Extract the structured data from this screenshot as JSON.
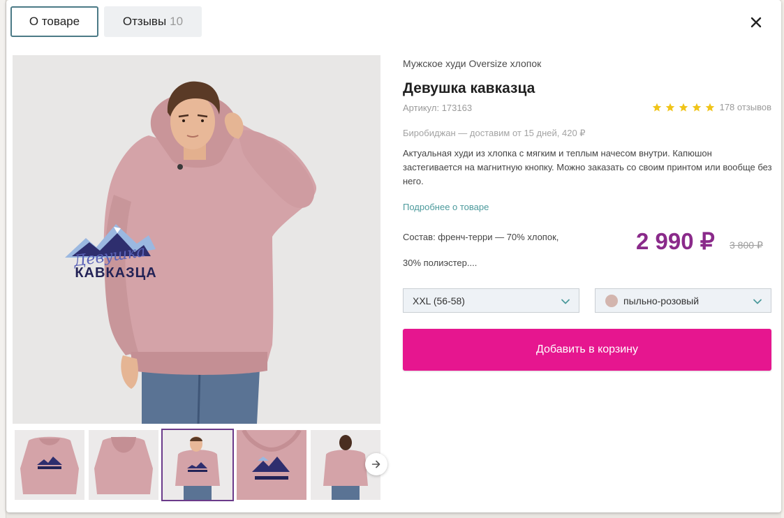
{
  "tabs": {
    "about_label": "О товаре",
    "reviews_label": "Отзывы",
    "reviews_count": "10"
  },
  "close_icon": "close-icon",
  "product": {
    "category": "Мужское худи Oversize хлопок",
    "title": "Девушка кавказца",
    "sku": "Артикул: 173163",
    "rating_stars": 5,
    "reviews_text": "178 отзывов",
    "delivery": "Биробиджан — доставим от 15 дней, 420 ₽",
    "description": "Актуальная худи из хлопка с мягким и теплым начесом внутри. Капюшон застегивается на магнитную кнопку. Можно заказать со своим принтом или вообще без него.",
    "more_link": "Подробнее о товаре",
    "composition_line1": "Состав: френч-терри — 70% хлопок,",
    "composition_line2": "30% полиэстер....",
    "price": "2 990 ₽",
    "old_price": "3 800 ₽"
  },
  "print": {
    "line1": "Девушка",
    "line2": "КАВКАЗЦА"
  },
  "selects": {
    "size_value": "XXL (56-58)",
    "color_value": "пыльно-розовый"
  },
  "cart": {
    "button_label": "Добавить в корзину"
  },
  "thumbnails": {
    "active_index": 2,
    "next_icon": "arrow-right-icon"
  },
  "colors": {
    "accent": "#e6168f",
    "price": "#8a2a8a",
    "link": "#4c9a9c",
    "star": "#f0c419",
    "hoodie": "#d4a3a8",
    "tab_border": "#4b7a86"
  }
}
